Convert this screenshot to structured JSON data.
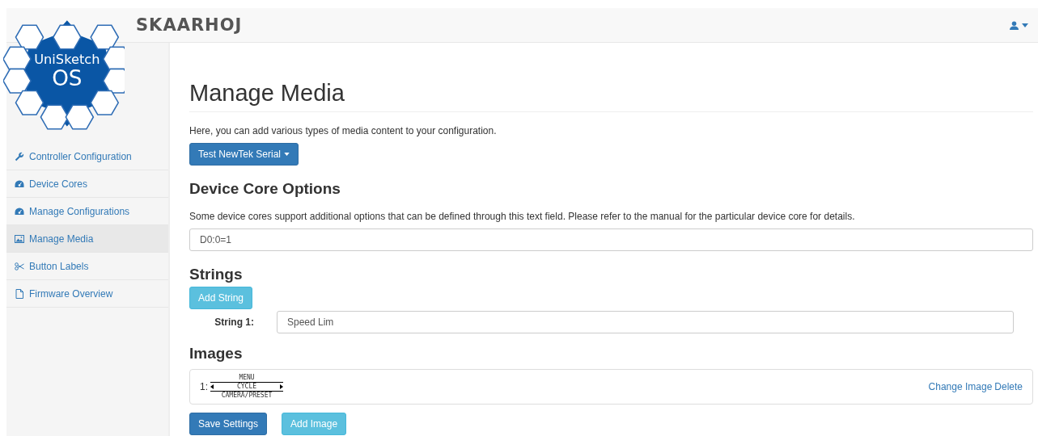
{
  "logo": {
    "line1": "UniSketch",
    "line2": "OS"
  },
  "brand": "SKAARHOJ",
  "sidebar": {
    "items": [
      {
        "label": "Controller Configuration",
        "selected": false
      },
      {
        "label": "Device Cores",
        "selected": false
      },
      {
        "label": "Manage Configurations",
        "selected": false
      },
      {
        "label": "Manage Media",
        "selected": true
      },
      {
        "label": "Button Labels",
        "selected": false
      },
      {
        "label": "Firmware Overview",
        "selected": false
      }
    ]
  },
  "page": {
    "title": "Manage Media",
    "intro": "Here, you can add various types of media content to your configuration.",
    "device_dropdown": "Test NewTek Serial"
  },
  "device_core_options": {
    "heading": "Device Core Options",
    "description": "Some device cores support additional options that can be defined through this text field. Please refer to the manual for the particular device core for details.",
    "value": "D0:0=1"
  },
  "strings": {
    "heading": "Strings",
    "add_button": "Add String",
    "items": [
      {
        "label": "String 1:",
        "value": "Speed Lim"
      }
    ]
  },
  "images": {
    "heading": "Images",
    "items": [
      {
        "index": "1:",
        "top": "MENU",
        "middle": "CYCLE",
        "bottom": "CAMERA/PRESET",
        "change_link": "Change Image",
        "delete_link": "Delete"
      }
    ]
  },
  "buttons": [
    {
      "label": "Save Settings",
      "kind": "primary"
    },
    {
      "label": "Add Image",
      "kind": "info"
    }
  ]
}
